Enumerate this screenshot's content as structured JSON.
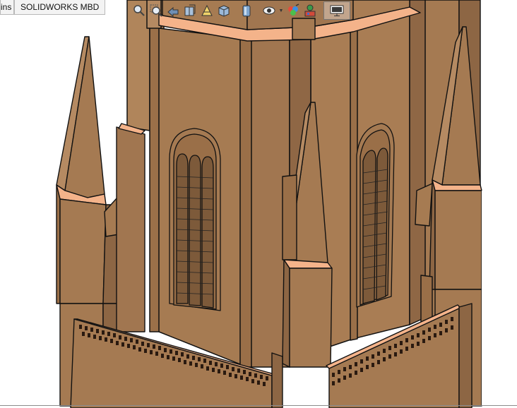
{
  "tabs": [
    {
      "label": "ins"
    },
    {
      "label": "SOLIDWORKS MBD"
    }
  ],
  "toolbar": {
    "icons": [
      "zoom-to-fit-icon",
      "zoom-to-area-icon",
      "previous-view-icon",
      "section-view-icon",
      "dynamic-annotation-icon",
      "view-orientation-icon",
      "display-style-icon",
      "hide-show-items-icon",
      "edit-appearance-icon",
      "apply-scene-icon",
      "view-settings-icon"
    ]
  },
  "colors": {
    "model_face": "#a57a52",
    "model_face_light": "#b58a62",
    "model_face_dark": "#8d6644",
    "highlight": "#f4b38a",
    "edge": "#111111",
    "background": "#ffffff"
  }
}
